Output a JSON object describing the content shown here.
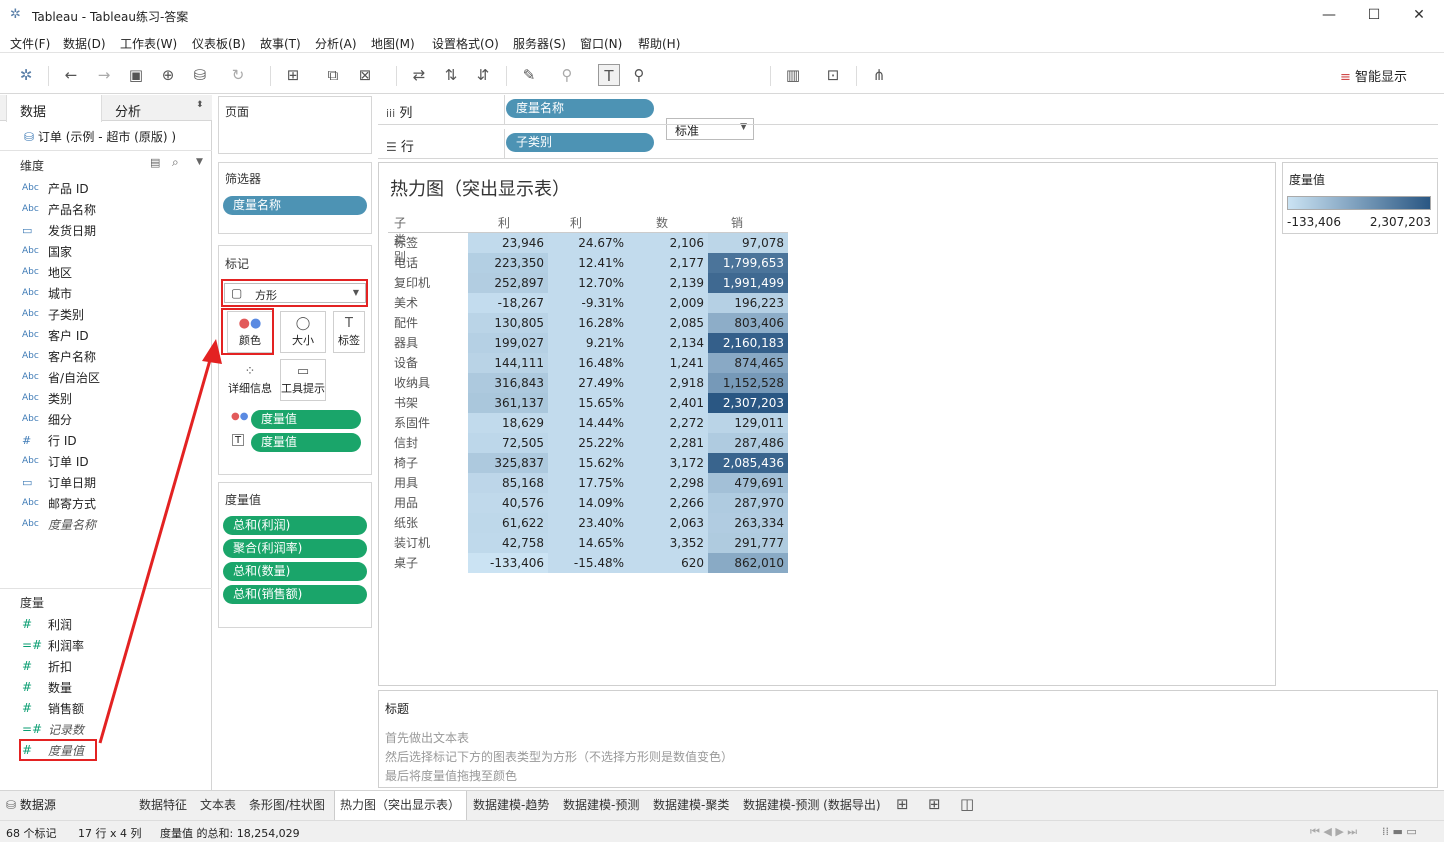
{
  "window": {
    "title": "Tableau - Tableau练习-答案",
    "minimize": "—",
    "maximize": "☐",
    "close": "✕"
  },
  "menu": [
    "文件(F)",
    "数据(D)",
    "工作表(W)",
    "仪表板(B)",
    "故事(T)",
    "分析(A)",
    "地图(M)",
    "设置格式(O)",
    "服务器(S)",
    "窗口(N)",
    "帮助(H)"
  ],
  "toolbar": {
    "fit_select": "标准",
    "smart_show": "智能显示"
  },
  "left_pane": {
    "tabs": {
      "data": "数据",
      "analysis": "分析"
    },
    "datasource": "订单 (示例 - 超市 (原版) )",
    "dimensions_header": "维度",
    "dimensions": [
      {
        "icon": "Abc",
        "label": "产品 ID"
      },
      {
        "icon": "Abc",
        "label": "产品名称"
      },
      {
        "icon": "date",
        "label": "发货日期"
      },
      {
        "icon": "Abc",
        "label": "国家"
      },
      {
        "icon": "Abc",
        "label": "地区"
      },
      {
        "icon": "Abc",
        "label": "城市"
      },
      {
        "icon": "Abc",
        "label": "子类别"
      },
      {
        "icon": "Abc",
        "label": "客户 ID"
      },
      {
        "icon": "Abc",
        "label": "客户名称"
      },
      {
        "icon": "Abc",
        "label": "省/自治区"
      },
      {
        "icon": "Abc",
        "label": "类别"
      },
      {
        "icon": "Abc",
        "label": "细分"
      },
      {
        "icon": "#",
        "label": "行 ID"
      },
      {
        "icon": "Abc",
        "label": "订单 ID"
      },
      {
        "icon": "date",
        "label": "订单日期"
      },
      {
        "icon": "Abc",
        "label": "邮寄方式"
      },
      {
        "icon": "Abc",
        "label": "度量名称"
      }
    ],
    "measures_header": "度量",
    "measures": [
      {
        "icon": "#",
        "label": "利润"
      },
      {
        "icon": "=#",
        "label": "利润率"
      },
      {
        "icon": "#",
        "label": "折扣"
      },
      {
        "icon": "#",
        "label": "数量"
      },
      {
        "icon": "#",
        "label": "销售额"
      },
      {
        "icon": "=#",
        "label": "记录数"
      },
      {
        "icon": "#",
        "label": "度量值"
      }
    ]
  },
  "shelves": {
    "pages": "页面",
    "columns_label": "列",
    "columns_pill": "度量名称",
    "rows_label": "行",
    "rows_pill": "子类别",
    "filters": "筛选器",
    "filter_pill": "度量名称",
    "marks": "标记",
    "mark_type": "方形",
    "mark_buttons": {
      "color": "颜色",
      "size": "大小",
      "label": "标签",
      "detail": "详细信息",
      "tooltip": "工具提示"
    },
    "mark_pills": [
      "度量值",
      "度量值"
    ],
    "measure_values_header": "度量值",
    "measure_values": [
      "总和(利润)",
      "聚合(利润率)",
      "总和(数量)",
      "总和(销售额)"
    ]
  },
  "viz": {
    "title": "热力图（突出显示表）",
    "headers": [
      "子类别",
      "利润",
      "利润率",
      "数量",
      "销售额"
    ],
    "rows": [
      [
        "标签",
        "23,946",
        "24.67%",
        "2,106",
        "97,078"
      ],
      [
        "电话",
        "223,350",
        "12.41%",
        "2,177",
        "1,799,653"
      ],
      [
        "复印机",
        "252,897",
        "12.70%",
        "2,139",
        "1,991,499"
      ],
      [
        "美术",
        "-18,267",
        "-9.31%",
        "2,009",
        "196,223"
      ],
      [
        "配件",
        "130,805",
        "16.28%",
        "2,085",
        "803,406"
      ],
      [
        "器具",
        "199,027",
        "9.21%",
        "2,134",
        "2,160,183"
      ],
      [
        "设备",
        "144,111",
        "16.48%",
        "1,241",
        "874,465"
      ],
      [
        "收纳具",
        "316,843",
        "27.49%",
        "2,918",
        "1,152,528"
      ],
      [
        "书架",
        "361,137",
        "15.65%",
        "2,401",
        "2,307,203"
      ],
      [
        "系固件",
        "18,629",
        "14.44%",
        "2,272",
        "129,011"
      ],
      [
        "信封",
        "72,505",
        "25.22%",
        "2,281",
        "287,486"
      ],
      [
        "椅子",
        "325,837",
        "15.62%",
        "3,172",
        "2,085,436"
      ],
      [
        "用具",
        "85,168",
        "17.75%",
        "2,298",
        "479,691"
      ],
      [
        "用品",
        "40,576",
        "14.09%",
        "2,266",
        "287,970"
      ],
      [
        "纸张",
        "61,622",
        "23.40%",
        "2,063",
        "263,334"
      ],
      [
        "装订机",
        "42,758",
        "14.65%",
        "3,352",
        "291,777"
      ],
      [
        "桌子",
        "-133,406",
        "-15.48%",
        "620",
        "862,010"
      ]
    ],
    "values": [
      [
        23946,
        24.67,
        2106,
        97078
      ],
      [
        223350,
        12.41,
        2177,
        1799653
      ],
      [
        252897,
        12.7,
        2139,
        1991499
      ],
      [
        -18267,
        -9.31,
        2009,
        196223
      ],
      [
        130805,
        16.28,
        2085,
        803406
      ],
      [
        199027,
        9.21,
        2134,
        2160183
      ],
      [
        144111,
        16.48,
        1241,
        874465
      ],
      [
        316843,
        27.49,
        2918,
        1152528
      ],
      [
        361137,
        15.65,
        2401,
        2307203
      ],
      [
        18629,
        14.44,
        2272,
        129011
      ],
      [
        72505,
        25.22,
        2281,
        287486
      ],
      [
        325837,
        15.62,
        3172,
        2085436
      ],
      [
        85168,
        17.75,
        2298,
        479691
      ],
      [
        40576,
        14.09,
        2266,
        287970
      ],
      [
        61622,
        23.4,
        2063,
        263334
      ],
      [
        42758,
        14.65,
        3352,
        291777
      ],
      [
        -133406,
        -15.48,
        620,
        862010
      ]
    ],
    "color_min": -133406,
    "color_max": 2307203
  },
  "legend": {
    "title": "度量值",
    "min": "-133,406",
    "max": "2,307,203",
    "color_low": "#cbe3f3",
    "color_high": "#2a5783"
  },
  "caption": {
    "title": "标题",
    "lines": [
      "首先做出文本表",
      "然后选择标记下方的图表类型为方形（不选择方形则是数值变色）",
      "最后将度量值拖拽至颜色"
    ]
  },
  "sheet_tabs": [
    "数据源",
    "数据特征",
    "文本表",
    "条形图/柱状图",
    "热力图（突出显示表）",
    "数据建模-趋势",
    "数据建模-预测",
    "数据建模-聚类",
    "数据建模-预测 (数据导出)"
  ],
  "status": {
    "marks": "68 个标记",
    "dims": "17 行 x 4 列",
    "sum": "度量值 的总和: 18,254,029"
  }
}
